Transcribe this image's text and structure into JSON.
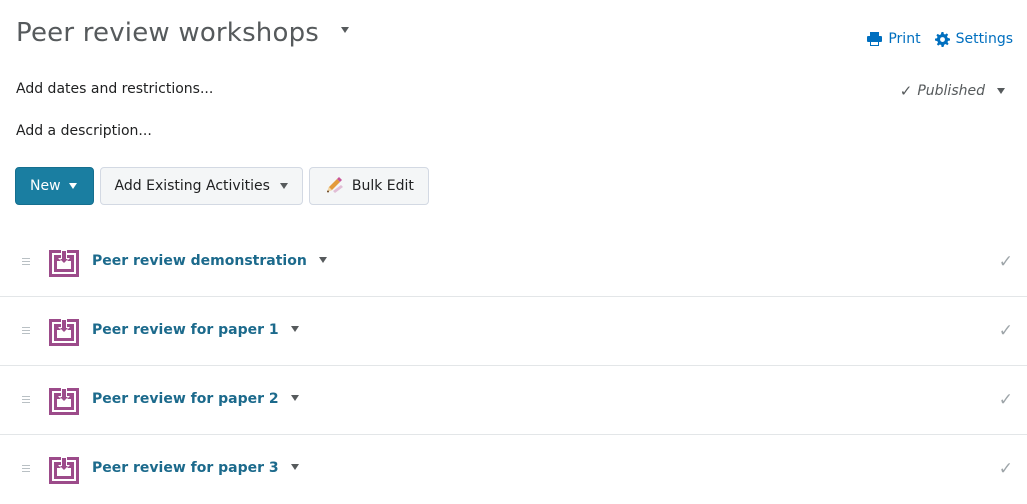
{
  "header": {
    "title": "Peer review workshops",
    "print_label": "Print",
    "settings_label": "Settings"
  },
  "info": {
    "dates_link": "Add dates and restrictions...",
    "description_link": "Add a description...",
    "status": "Published",
    "status_check": "✓"
  },
  "toolbar": {
    "new_label": "New",
    "add_existing_label": "Add Existing Activities",
    "bulk_edit_label": "Bulk Edit"
  },
  "items": [
    {
      "title": "Peer review demonstration",
      "check": "✓"
    },
    {
      "title": "Peer review for paper 1",
      "check": "✓"
    },
    {
      "title": "Peer review for paper 2",
      "check": "✓"
    },
    {
      "title": "Peer review for paper 3",
      "check": "✓"
    }
  ],
  "colors": {
    "primary_button": "#1a7ea1",
    "link": "#006fbf",
    "item_title": "#1c6a8c",
    "activity_icon": "#9c4b8a"
  },
  "icons": {
    "title_menu": "chevron-down-icon",
    "print": "printer-icon",
    "settings": "gear-icon",
    "bulk_edit": "pencil-icon",
    "drag": "drag-handle-icon",
    "activity": "assignment-submission-icon",
    "completion": "checkmark-icon"
  }
}
